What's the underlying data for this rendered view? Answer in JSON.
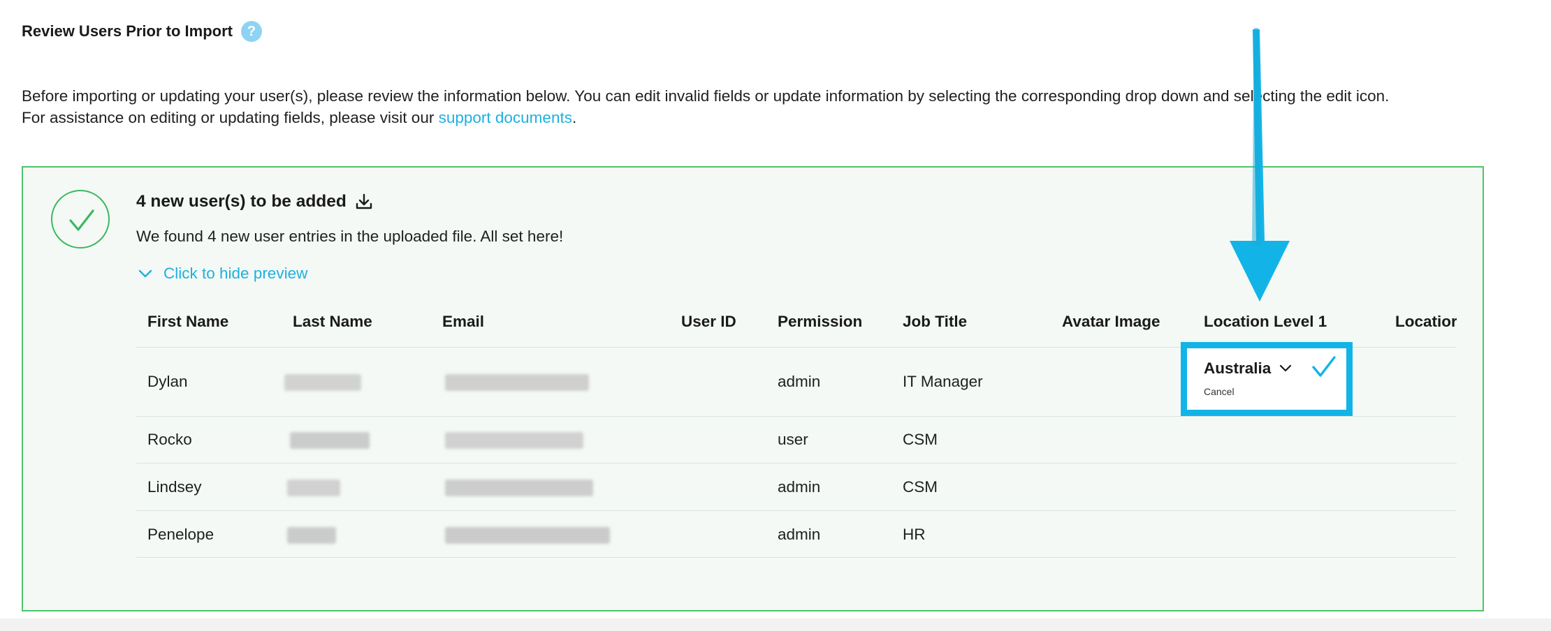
{
  "header": {
    "title": "Review Users Prior to Import",
    "help_icon": "question-mark"
  },
  "intro": {
    "line1_before": "Before importing or updating your user(s), please review the information below. You can edit invalid fields or update information by selecting the corresponding drop",
    "line1_after": "down and selecting the edit icon.",
    "line2_prefix": "For assistance on editing or updating fields, please visit our ",
    "link_text": "support documents",
    "line2_suffix": "."
  },
  "summary": {
    "title": "4 new user(s) to be added",
    "description": "We found 4 new user entries in the uploaded file. All set here!",
    "toggle_label": "Click to hide preview"
  },
  "table": {
    "columns": [
      "First Name",
      "Last Name",
      "Email",
      "User ID",
      "Permission",
      "Job Title",
      "Avatar Image",
      "Location Level 1",
      "Locatior"
    ],
    "rows": [
      {
        "first_name": "Dylan",
        "permission": "admin",
        "job_title": "IT Manager"
      },
      {
        "first_name": "Rocko",
        "permission": "user",
        "job_title": "CSM"
      },
      {
        "first_name": "Lindsey",
        "permission": "admin",
        "job_title": "CSM"
      },
      {
        "first_name": "Penelope",
        "permission": "admin",
        "job_title": "HR"
      }
    ]
  },
  "location_editor": {
    "value": "Australia",
    "cancel_label": "Cancel"
  },
  "colors": {
    "accent": "#1fb0e0",
    "success": "#3cb860",
    "panel_bg": "#f4f9f5",
    "highlight": "#12b4e8"
  }
}
